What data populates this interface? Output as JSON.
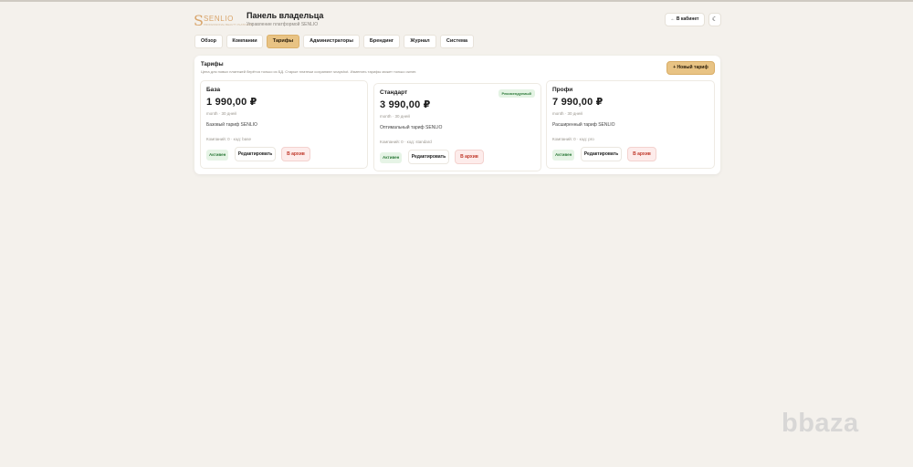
{
  "brand": {
    "mark": "S",
    "name": "SENLIO",
    "tagline": "PROFESSIONAL BEAUTY PLATFORM"
  },
  "header": {
    "title": "Панель владельца",
    "subtitle": "Управление платформой SENLIO",
    "cabinet_button": "← В кабинет",
    "theme_icon": "moon-icon",
    "theme_glyph": "☾"
  },
  "tabs": [
    {
      "label": "Обзор",
      "active": false
    },
    {
      "label": "Компании",
      "active": false
    },
    {
      "label": "Тарифы",
      "active": true
    },
    {
      "label": "Администраторы",
      "active": false
    },
    {
      "label": "Брендинг",
      "active": false
    },
    {
      "label": "Журнал",
      "active": false
    },
    {
      "label": "Система",
      "active": false
    }
  ],
  "panel": {
    "title": "Тарифы",
    "note": "Цена для новых платежей берётся только из БД. Старые платежи сохраняют snapshot. Изменять тарифы может только owner.",
    "new_button": "+ Новый тариф"
  },
  "plans": [
    {
      "name": "База",
      "price": "1 990,00 ₽",
      "period": "month · 30 дней",
      "description": "Базовый тариф SENLIO",
      "meta": "Компаний: 0 · код: base",
      "recommended": "",
      "status": "Активен",
      "edit": "Редактировать",
      "archive": "В архив"
    },
    {
      "name": "Стандарт",
      "price": "3 990,00 ₽",
      "period": "month · 30 дней",
      "description": "Оптимальный тариф SENLIO",
      "meta": "Компаний: 0 · код: standard",
      "recommended": "Рекомендуемый",
      "status": "Активен",
      "edit": "Редактировать",
      "archive": "В архив"
    },
    {
      "name": "Профи",
      "price": "7 990,00 ₽",
      "period": "month · 30 дней",
      "description": "Расширенный тариф SENLIO",
      "meta": "Компаний: 0 · код: pro",
      "recommended": "",
      "status": "Активен",
      "edit": "Редактировать",
      "archive": "В архив"
    }
  ],
  "watermark": "bbaza",
  "colors": {
    "accent": "#e8c384",
    "background": "#f4f1ec",
    "active_green": "#2d7a3a",
    "archive_red": "#c0392b"
  }
}
